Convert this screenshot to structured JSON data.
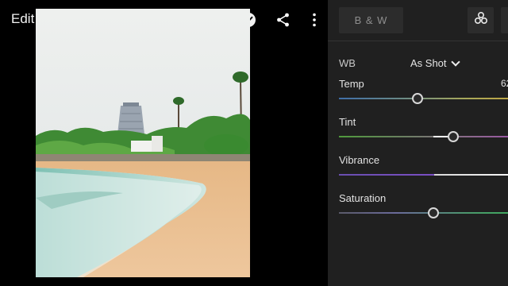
{
  "header": {
    "title": "Edit"
  },
  "photo": {
    "subject": "beach-with-temple-tower"
  },
  "panel": {
    "bw_label": "B & W",
    "wb": {
      "label": "WB",
      "value": "As Shot"
    },
    "sliders": {
      "temp": {
        "label": "Temp",
        "value": "62",
        "level": 0.42
      },
      "tint": {
        "label": "Tint",
        "value": "",
        "level": 0.6
      },
      "vibrance": {
        "label": "Vibrance",
        "value": "",
        "level": 0.5
      },
      "saturation": {
        "label": "Saturation",
        "value": "",
        "level": 0.5
      }
    }
  },
  "colors": {
    "background": "#000000",
    "panel": "#202020",
    "button": "#2c2c2c",
    "temp_cool": "#3f6ea8",
    "temp_warm": "#c9a43a",
    "tint_green": "#4f9a3c",
    "tint_magenta": "#a04fae",
    "vibrance": "#7a4fc4"
  },
  "icons": [
    "chevron-down-icon",
    "undo-icon",
    "help-icon",
    "checkmark-icon",
    "share-icon",
    "more-vertical-icon",
    "profiles-icon"
  ]
}
